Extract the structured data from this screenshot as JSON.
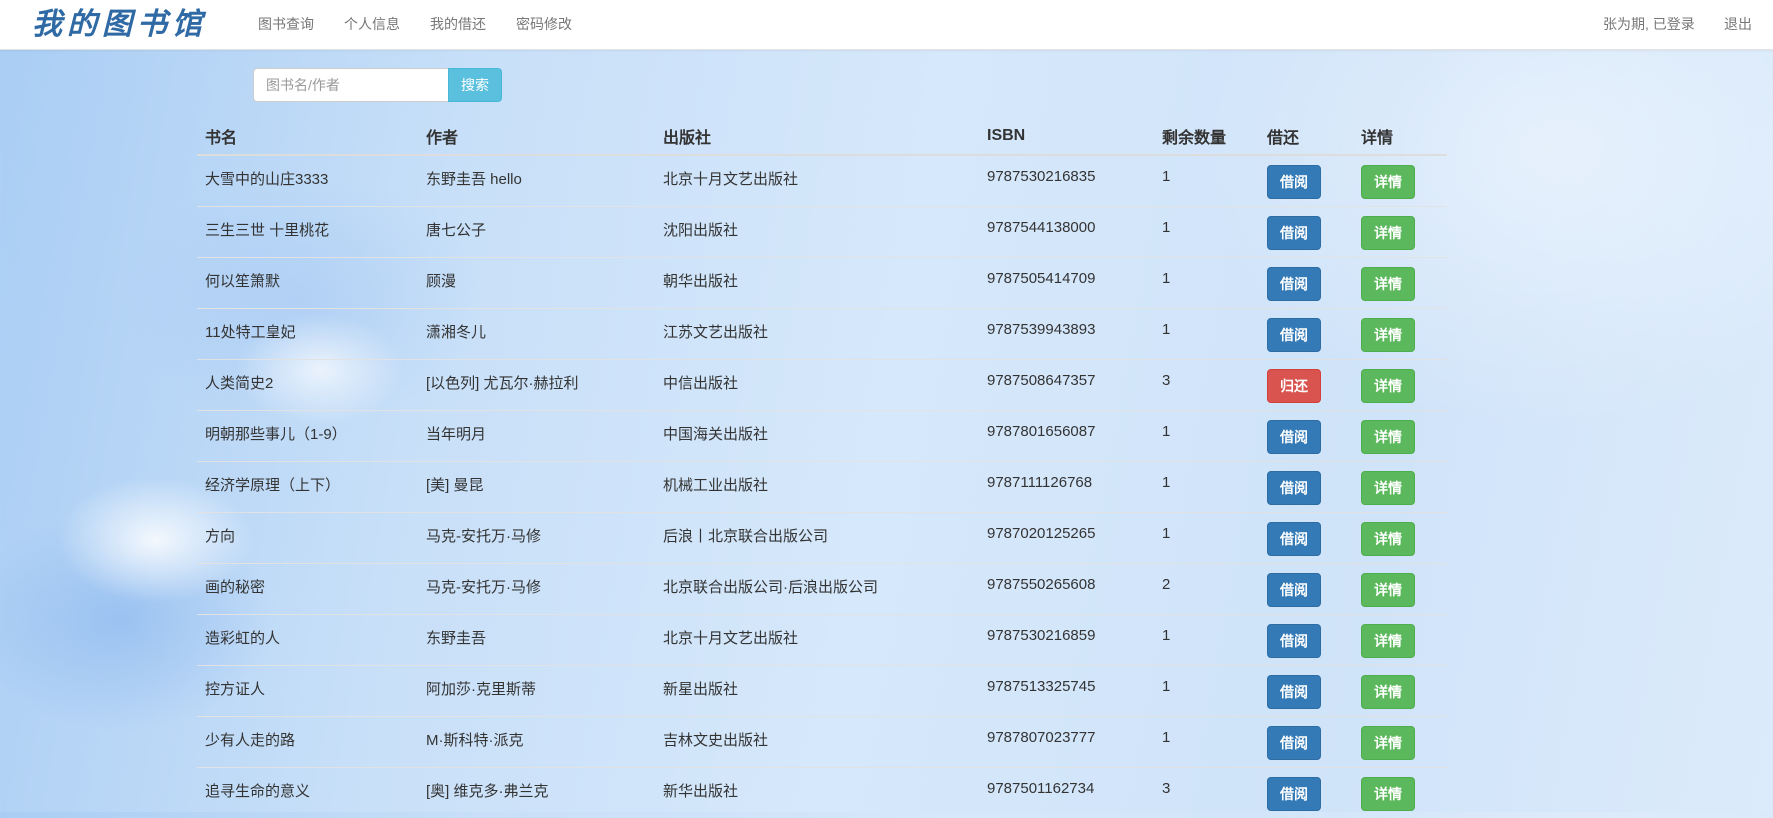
{
  "brand": "我的图书馆",
  "nav": {
    "items": [
      "图书查询",
      "个人信息",
      "我的借还",
      "密码修改"
    ],
    "user_status": "张为期, 已登录",
    "logout": "退出"
  },
  "search": {
    "placeholder": "图书名/作者",
    "value": "",
    "button": "搜索"
  },
  "table": {
    "headers": [
      "书名",
      "作者",
      "出版社",
      "ISBN",
      "剩余数量",
      "借还",
      "详情"
    ],
    "rows": [
      {
        "title": "大雪中的山庄3333",
        "author": "东野圭吾 hello",
        "publisher": "北京十月文艺出版社",
        "isbn": "9787530216835",
        "remaining": "1",
        "action": "借阅",
        "detail": "详情"
      },
      {
        "title": "三生三世 十里桃花",
        "author": "唐七公子",
        "publisher": "沈阳出版社",
        "isbn": "9787544138000",
        "remaining": "1",
        "action": "借阅",
        "detail": "详情"
      },
      {
        "title": "何以笙箫默",
        "author": "顾漫",
        "publisher": "朝华出版社",
        "isbn": "9787505414709",
        "remaining": "1",
        "action": "借阅",
        "detail": "详情"
      },
      {
        "title": "11处特工皇妃",
        "author": "潇湘冬儿",
        "publisher": "江苏文艺出版社",
        "isbn": "9787539943893",
        "remaining": "1",
        "action": "借阅",
        "detail": "详情"
      },
      {
        "title": "人类简史2",
        "author": "[以色列] 尤瓦尔·赫拉利",
        "publisher": "中信出版社",
        "isbn": "9787508647357",
        "remaining": "3",
        "action": "归还",
        "detail": "详情"
      },
      {
        "title": "明朝那些事儿（1-9）",
        "author": "当年明月",
        "publisher": "中国海关出版社",
        "isbn": "9787801656087",
        "remaining": "1",
        "action": "借阅",
        "detail": "详情"
      },
      {
        "title": "经济学原理（上下）",
        "author": "[美] 曼昆",
        "publisher": "机械工业出版社",
        "isbn": "9787111126768",
        "remaining": "1",
        "action": "借阅",
        "detail": "详情"
      },
      {
        "title": "方向",
        "author": "马克-安托万·马修",
        "publisher": "后浪丨北京联合出版公司",
        "isbn": "9787020125265",
        "remaining": "1",
        "action": "借阅",
        "detail": "详情"
      },
      {
        "title": "画的秘密",
        "author": "马克-安托万·马修",
        "publisher": "北京联合出版公司·后浪出版公司",
        "isbn": "9787550265608",
        "remaining": "2",
        "action": "借阅",
        "detail": "详情"
      },
      {
        "title": "造彩虹的人",
        "author": "东野圭吾",
        "publisher": "北京十月文艺出版社",
        "isbn": "9787530216859",
        "remaining": "1",
        "action": "借阅",
        "detail": "详情"
      },
      {
        "title": "控方证人",
        "author": "阿加莎·克里斯蒂",
        "publisher": "新星出版社",
        "isbn": "9787513325745",
        "remaining": "1",
        "action": "借阅",
        "detail": "详情"
      },
      {
        "title": "少有人走的路",
        "author": "M·斯科特·派克",
        "publisher": "吉林文史出版社",
        "isbn": "9787807023777",
        "remaining": "1",
        "action": "借阅",
        "detail": "详情"
      },
      {
        "title": "追寻生命的意义",
        "author": "[奥] 维克多·弗兰克",
        "publisher": "新华出版社",
        "isbn": "9787501162734",
        "remaining": "3",
        "action": "借阅",
        "detail": "详情"
      }
    ]
  }
}
